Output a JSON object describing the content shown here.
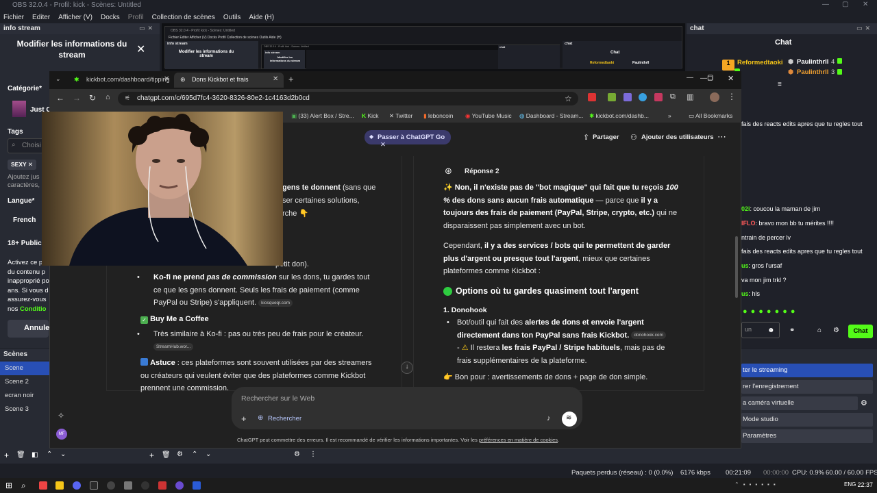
{
  "obs": {
    "title": "OBS 32.0.4 - Profil: kick - Scènes: Untitled",
    "menu": [
      "Fichier",
      "Editer",
      "Afficher (V)",
      "Docks",
      "Profil",
      "Collection de scènes",
      "Outils",
      "Aide (H)"
    ],
    "info_dock_title": "info stream",
    "chat_dock_title": "chat",
    "scenes_dock_title": "Scènes",
    "preview_text": {
      "title": "OBS 32.0.4 - Profil: kick - Scènes: Untitled",
      "menu": "Fichier  Editer  Afficher (V)  Docks  Profil  Collection de scènes  Outils  Aide (H)",
      "info": "info stream",
      "modifier": "Modifier les informations du stream",
      "chat": "chat",
      "chat2": "Chat",
      "user1": "Reformedtaoki",
      "user2": "Paulinthrll",
      "inner_info": "info stream",
      "inner_modifier": "Modifier les informations du stream",
      "inner_chat": "chat"
    }
  },
  "info_stream": {
    "heading": "Modifier les informations du stream",
    "categorie_label": "Catégorie*",
    "categorie_value": "Just C",
    "tags_label": "Tags",
    "tags_placeholder": "Choisi",
    "tag_chip": "SEXY ✕",
    "help_line1": "Ajoutez jus",
    "help_line2": "caractères,",
    "langue_label": "Langue*",
    "langue_value": "French",
    "public_label": "18+ Public r",
    "warn_lines": [
      "Activez ce p",
      "du contenu p",
      "inapproprié po",
      "ans. Si vous d",
      "assurez-vous",
      "nos "
    ],
    "warn_link": "Conditio",
    "annuler": "Annule"
  },
  "chat": {
    "title": "Chat",
    "top_user1": "Reformedtaoki",
    "top_user2": "Paulinthrll",
    "top_user2_count": "4",
    "top_user3": "Paulinthrll",
    "top_user3_count": "3",
    "messages": [
      {
        "user": "",
        "text": "fais des reacts edits apres que tu regles tout"
      },
      {
        "user": "02i",
        "text": ": coucou la maman de jim"
      },
      {
        "user": "IFLO",
        "text": ": bravo mon bb tu mérites !!!!"
      },
      {
        "user": "",
        "text": "ntrain de percer lv"
      },
      {
        "user": "",
        "text": "fais des reacts edits apres que tu regles tout"
      },
      {
        "user": "us",
        "text": ": gros l'ursaf"
      },
      {
        "user": "",
        "text": "va mon jim trkl ?"
      },
      {
        "user": "us",
        "text": ": hls"
      }
    ],
    "input_placeholder": "un",
    "send_label": "Chat"
  },
  "scenes": [
    "Scene",
    "Scene 2",
    "ecran noir",
    "Scene 3"
  ],
  "controls": [
    "ter le streaming",
    "rer l'enregistrement",
    "a caméra virtuelle",
    "Mode studio",
    "Paramètres"
  ],
  "status": {
    "lost": "Paquets perdus (réseau) : 0 (0.0%)",
    "kbps": "6176 kbps",
    "live_time": "00:21:09",
    "rec_time": "00:00:00",
    "cpu": "CPU: 0.9%",
    "fps": "60.00 / 60.00 FPS"
  },
  "chrome": {
    "tabs": [
      {
        "label": "kickbot.com/dashboard/tipping"
      },
      {
        "label": "Dons Kickbot et frais"
      }
    ],
    "url": "chatgpt.com/c/695d7fc4-3620-8326-80e2-1c4163d2b0cd",
    "bookmarks": [
      "(33) Alert Box / Stre...",
      "Kick",
      "Twitter",
      "leboncoin",
      "YouTube Music",
      "Dashboard - Stream...",
      "kickbot.com/dashb..."
    ],
    "all_bookmarks": "All Bookmarks"
  },
  "gpt": {
    "go_label": "Passer à ChatGPT Go",
    "partager": "Partager",
    "ajouter": "Ajouter des utilisateurs",
    "left": {
      "l1a": "gens te donnent",
      "l1b": " (sans que",
      "l2": "ser certaines solutions,",
      "l3": "rche 👇",
      "l4": "petit don).",
      "kofi_b": "Ko-fi ne prend ",
      "kofi_i": "pas de commission",
      "kofi_rest": " sur les dons, tu gardes tout ce que les gens donnent. Seuls les frais de paiement (comme PayPal ou Stripe) s'appliquent.",
      "kofi_src": "kiosqueqr.com",
      "bmac": "Buy Me a Coffee",
      "bmac_text": "Très similaire à Ko-fi : pas ou très peu de frais pour le créateur.",
      "bmac_src": "StreamHub.wor...",
      "astuce_b": "Astuce",
      "astuce_text": " : ces plateformes sont souvent utilisées par des streamers ou créateurs qui veulent éviter que des plateformes comme Kickbot prennent une commission."
    },
    "right": {
      "response": "Réponse 2",
      "p1_b1": "Non, il n'existe pas de \"bot magique\" qui fait que tu reçois ",
      "p1_i": "100 %",
      "p1_b2": "des dons sans aucun frais automatique",
      "p1_mid": " — parce que ",
      "p1_b3": "il y a toujours des frais de paiement (PayPal, Stripe, crypto, etc.)",
      "p1_end": " qui ne disparaissent pas simplement avec un bot.",
      "p2_a": "Cependant, ",
      "p2_b": "il y a des services / bots qui te permettent de garder plus d'argent ou presque tout l'argent",
      "p2_c": ", mieux que certaines plateformes comme Kickbot :",
      "h_options": "Options où tu gardes quasiment tout l'argent",
      "h_donohook": "1. Donohook",
      "d1_a": "Bot/outil qui fait des ",
      "d1_b": "alertes de dons et envoie l'argent directement dans ton PayPal sans frais Kickbot.",
      "d1_src": "donohook.com",
      "d2_a": "Il restera ",
      "d2_b": "les frais PayPal / Stripe habituels",
      "d2_c": ", mais pas de frais supplémentaires de la plateforme.",
      "bonpour": "Bon pour : avertissements de dons + page de don simple."
    },
    "composer_placeholder": "Rechercher sur le Web",
    "rechercher": "Rechercher",
    "disclaimer_a": "ChatGPT peut commettre des erreurs. Il est recommandé de vérifier les informations importantes. Voir les ",
    "disclaimer_link": "préférences en matière de cookies",
    "disclaimer_end": "."
  },
  "taskbar": {
    "lang": "ENG",
    "time": "22:37"
  },
  "colors": {
    "kick_green": "#53fc18",
    "obs_blue": "#284fb5",
    "gpt_bg": "#212121"
  }
}
